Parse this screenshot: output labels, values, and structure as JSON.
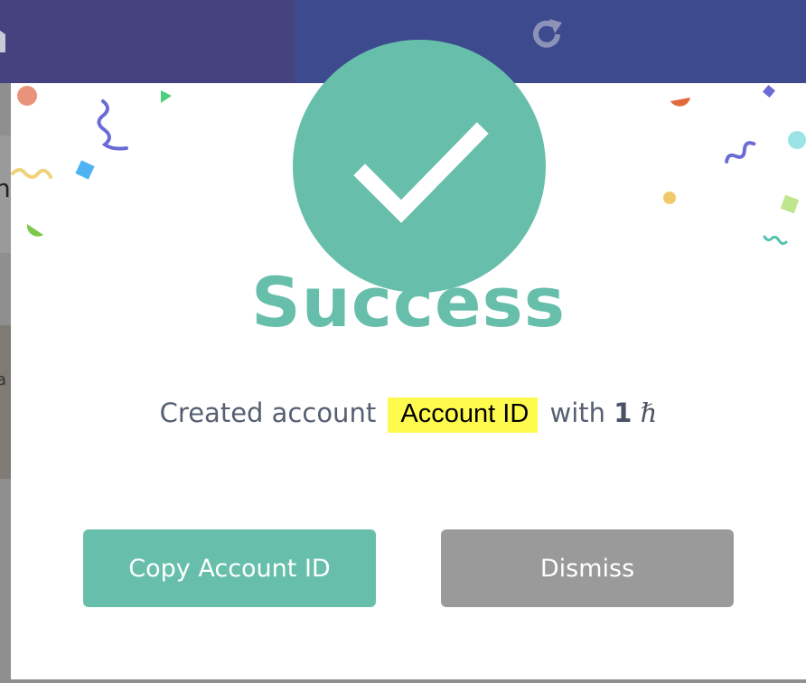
{
  "modal": {
    "title": "Success",
    "message": {
      "prefix": "Created account",
      "account_id": "Account ID",
      "middle": "with",
      "amount": "1",
      "currency_symbol": "ℏ"
    },
    "buttons": {
      "copy_label": "Copy Account ID",
      "dismiss_label": "Dismiss"
    },
    "icon": "checkmark-icon"
  },
  "background": {
    "page_text": "n",
    "page_text2": "a",
    "icons": [
      "home-icon",
      "refresh-icon"
    ]
  },
  "colors": {
    "accent": "#67bfab",
    "highlight": "#fefb4e",
    "dismiss": "#9a9a9a",
    "topbar": "#3e4a8e"
  }
}
